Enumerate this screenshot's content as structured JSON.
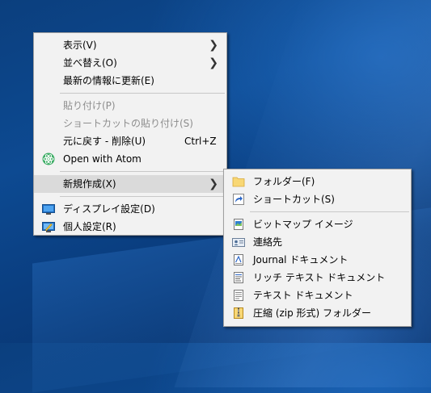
{
  "desktop_menu": {
    "items": [
      {
        "label": "表示(V)"
      },
      {
        "label": "並べ替え(O)"
      },
      {
        "label": "最新の情報に更新(E)"
      },
      {
        "label": "貼り付け(P)"
      },
      {
        "label": "ショートカットの貼り付け(S)"
      },
      {
        "label": "元に戻す - 削除(U)",
        "shortcut": "Ctrl+Z"
      },
      {
        "label": "Open with Atom",
        "icon": "atom-icon"
      },
      {
        "label": "新規作成(X)"
      },
      {
        "label": "ディスプレイ設定(D)",
        "icon": "display-icon"
      },
      {
        "label": "個人設定(R)",
        "icon": "personalize-icon"
      }
    ]
  },
  "new_submenu": {
    "items": [
      {
        "label": "フォルダー(F)",
        "icon": "folder-icon"
      },
      {
        "label": "ショートカット(S)",
        "icon": "shortcut-icon"
      },
      {
        "label": "ビットマップ イメージ",
        "icon": "bitmap-icon"
      },
      {
        "label": "連絡先",
        "icon": "contact-icon"
      },
      {
        "label": "Journal ドキュメント",
        "icon": "journal-icon"
      },
      {
        "label": "リッチ テキスト ドキュメント",
        "icon": "rtf-icon"
      },
      {
        "label": "テキスト ドキュメント",
        "icon": "text-doc-icon"
      },
      {
        "label": "圧縮 (zip 形式) フォルダー",
        "icon": "zip-folder-icon"
      }
    ]
  },
  "colors": {
    "menu_bg": "#f2f2f2",
    "highlight": "#dadada",
    "disabled_text": "#8d8d8d",
    "desktop_blue": "#0d4a92"
  }
}
